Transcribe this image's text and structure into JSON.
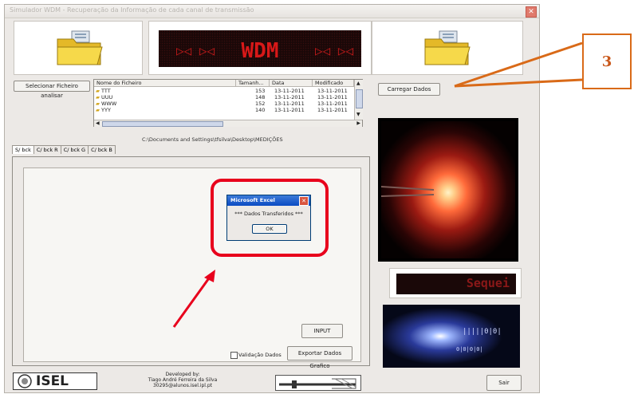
{
  "window": {
    "title": "Simulador WDM - Recuperação da Informação de cada canal de transmissão",
    "close_glyph": "✕"
  },
  "led_banner": {
    "text": "WDM",
    "arrows": "▷◁ ▷◁",
    "color": "#d81818"
  },
  "select_button": "Selecionar Ficheiro analisar",
  "load_button": "Carregar Dados",
  "file_list": {
    "headers": [
      "Nome do Ficheiro",
      "Tamanh...",
      "Data",
      "Modificado"
    ],
    "rows": [
      {
        "name": "TTT",
        "size": "153",
        "date": "13-11-2011",
        "modified": "13-11-2011"
      },
      {
        "name": "UUU",
        "size": "148",
        "date": "13-11-2011",
        "modified": "13-11-2011"
      },
      {
        "name": "WWW",
        "size": "152",
        "date": "13-11-2011",
        "modified": "13-11-2011"
      },
      {
        "name": "YYY",
        "size": "140",
        "date": "13-11-2011",
        "modified": "13-11-2011"
      }
    ]
  },
  "path": "C:\\Documents and Settings\\tfsilva\\Desktop\\MEDIÇÕES",
  "tabs": [
    "S/ bck",
    "C/ bck R",
    "C/ bck G",
    "C/ bck B"
  ],
  "dialog": {
    "title": "Microsoft Excel",
    "message": "*** Dados Transferidos ***",
    "ok": "OK"
  },
  "input_button": "INPUT",
  "validation_label": "Validação Dados",
  "export_button": "Exportar Dados Grafico",
  "small_led_text": "Sequei",
  "developed_by": {
    "line1": "Developed by:",
    "line2": "Tiago André Ferreira da Silva",
    "line3": "30295@alunos.isel.ipl.pt"
  },
  "logo_text": "ISEL",
  "exit_button": "Sair",
  "callout_number": "3",
  "accent_colors": {
    "callout": "#d96a18",
    "highlight": "#e8001c"
  },
  "icons": [
    "folder-icon",
    "folder-icon",
    "close-icon",
    "checkbox-icon",
    "arrow-icon"
  ]
}
